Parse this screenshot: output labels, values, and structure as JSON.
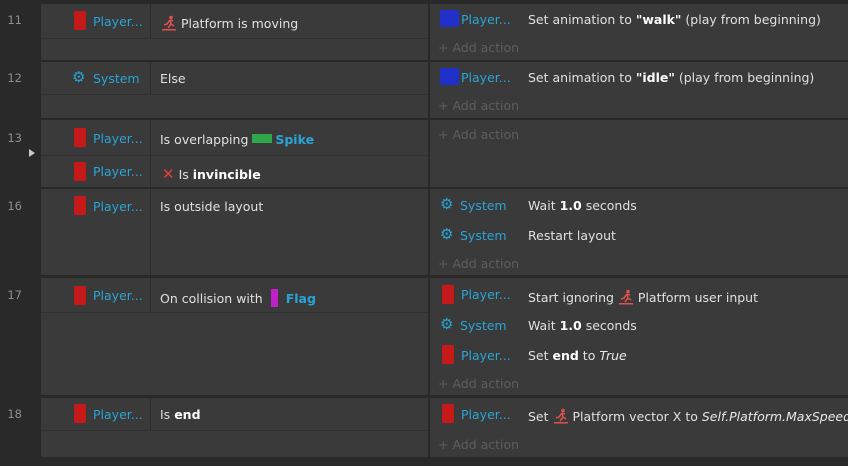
{
  "add_action_label": "+ Add action",
  "rows": [
    {
      "line": "11",
      "conditions": [
        {
          "object": "Player...",
          "text_parts": [
            "Platform is moving"
          ]
        }
      ],
      "actions": [
        {
          "object": "Player...",
          "text_pre": "Set animation to ",
          "bold": "\"walk\"",
          "text_post": " (play from beginning)"
        }
      ]
    },
    {
      "line": "12",
      "conditions": [
        {
          "object": "System",
          "text": "Else"
        }
      ],
      "actions": [
        {
          "object": "Player...",
          "text_pre": "Set animation to ",
          "bold": "\"idle\"",
          "text_post": " (play from beginning)"
        }
      ]
    },
    {
      "line": "13",
      "conditions": [
        {
          "object": "Player...",
          "text_pre": "Is overlapping ",
          "target": "Spike"
        },
        {
          "object": "Player...",
          "text_pre": "Is ",
          "bold": "invincible"
        }
      ],
      "actions": []
    },
    {
      "line": "16",
      "conditions": [
        {
          "object": "Player...",
          "text": "Is outside layout"
        }
      ],
      "actions": [
        {
          "object": "System",
          "text_pre": "Wait ",
          "bold": "1.0",
          "text_post": " seconds"
        },
        {
          "object": "System",
          "text": "Restart layout"
        }
      ]
    },
    {
      "line": "17",
      "conditions": [
        {
          "object": "Player...",
          "text_pre": "On collision with ",
          "target": "Flag"
        }
      ],
      "actions": [
        {
          "object": "Player...",
          "text_pre": "Start ignoring ",
          "text_post": "Platform user input"
        },
        {
          "object": "System",
          "text_pre": "Wait ",
          "bold": "1.0",
          "text_post": " seconds"
        },
        {
          "object": "Player...",
          "text_pre": "Set ",
          "bold": "end",
          "text_mid": " to ",
          "italic": "True"
        }
      ]
    },
    {
      "line": "18",
      "conditions": [
        {
          "object": "Player...",
          "text_pre": "Is ",
          "bold": "end"
        }
      ],
      "actions": [
        {
          "object": "Player...",
          "text_pre": "Set ",
          "text_post": "Platform vector X to ",
          "italic": "Self.Platform.MaxSpeed"
        }
      ]
    }
  ],
  "colors": {
    "object_name": "#29a4d6",
    "player_swatch": "#c41a1a",
    "player_swatch_action": "#1f2fc8",
    "spike_swatch": "#2ea84a",
    "flag_swatch": "#c020c8",
    "panel_bg": "#3a3a3a",
    "page_bg": "#292929",
    "add_action": "#5d5d5d"
  }
}
